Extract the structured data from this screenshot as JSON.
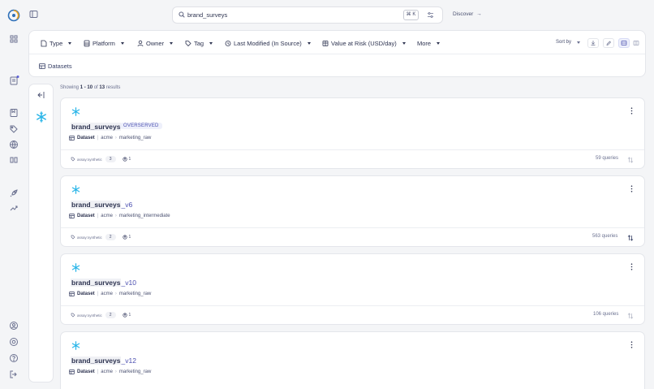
{
  "search": {
    "query": "brand_surveys",
    "shortcut": "⌘ K"
  },
  "nav": {
    "discover_label": "Discover",
    "discover_arrow": "→"
  },
  "filters": [
    {
      "label": "Type",
      "icon": "file-icon"
    },
    {
      "label": "Platform",
      "icon": "database-icon"
    },
    {
      "label": "Owner",
      "icon": "user-icon"
    },
    {
      "label": "Tag",
      "icon": "tag-icon"
    },
    {
      "label": "Last Modified (In Source)",
      "icon": "clock-icon"
    },
    {
      "label": "Value at Risk (USD/day)",
      "icon": "grid-icon"
    },
    {
      "label": "More",
      "icon": ""
    }
  ],
  "sort": {
    "label": "Sort by"
  },
  "breadcrumb": {
    "label": "Datasets"
  },
  "results": {
    "showing": "Showing",
    "range": "1 - 10",
    "of": "of",
    "total": "13",
    "suffix": "results"
  },
  "cards": [
    {
      "name_prefix": "brand_surveys",
      "name_suffix": "",
      "badge": "OVERSERVED",
      "type": "Dataset",
      "owner": "acme",
      "container": "marketing_raw",
      "tag": "assay:synthetic",
      "tag_count": "3",
      "owner_count": "1",
      "queries": "59 queries",
      "trend": "down"
    },
    {
      "name_prefix": "brand_surveys",
      "name_suffix": "_v6",
      "badge": "",
      "type": "Dataset",
      "owner": "acme",
      "container": "marketing_intermediate",
      "tag": "assay:synthetic",
      "tag_count": "2",
      "owner_count": "1",
      "queries": "563 queries",
      "trend": "up"
    },
    {
      "name_prefix": "brand_surveys",
      "name_suffix": "_v10",
      "badge": "",
      "type": "Dataset",
      "owner": "acme",
      "container": "marketing_raw",
      "tag": "assay:synthetic",
      "tag_count": "2",
      "owner_count": "1",
      "queries": "106 queries",
      "trend": "down"
    },
    {
      "name_prefix": "brand_surveys",
      "name_suffix": "_v12",
      "badge": "",
      "type": "Dataset",
      "owner": "acme",
      "container": "marketing_raw",
      "tag": "",
      "tag_count": "",
      "owner_count": "",
      "queries": "",
      "trend": ""
    }
  ],
  "colors": {
    "accent": "#4b4fb0",
    "platform": "#29b5e8",
    "notification": "#5b5fd6"
  }
}
